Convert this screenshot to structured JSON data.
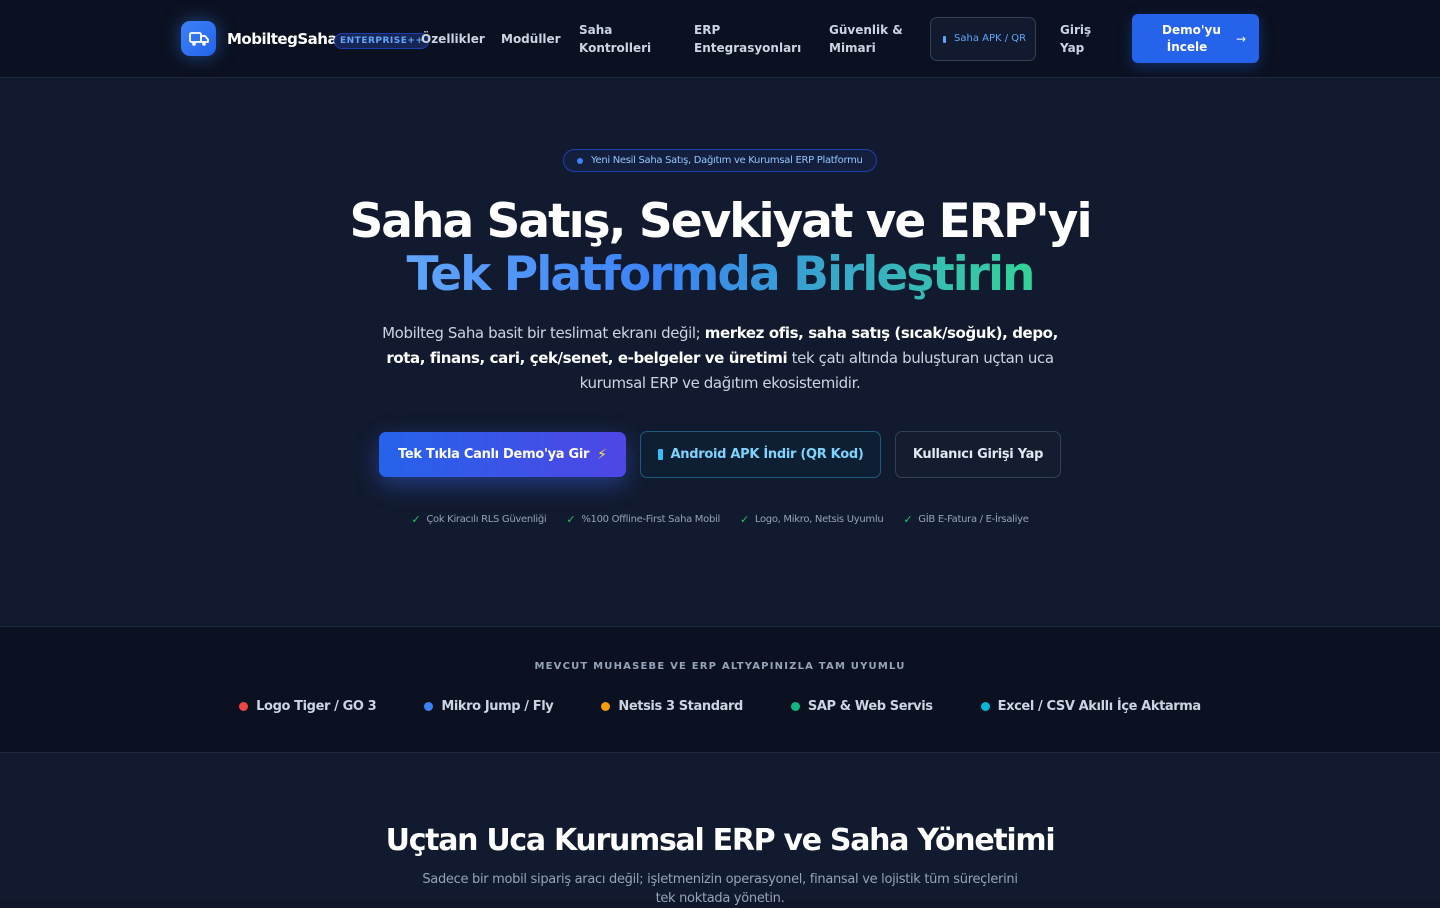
{
  "nav": {
    "brand": "MobiltegSaha",
    "badge": "ENTERPRISE++",
    "links": [
      {
        "label": "Özellikler"
      },
      {
        "label": "Modüller"
      },
      {
        "label": "Saha Kontrolleri"
      },
      {
        "label": "ERP Entegrasyonları"
      },
      {
        "label": "Güvenlik & Mimari"
      }
    ],
    "apk_label": "Saha APK / QR",
    "login_label": "Giriş Yap",
    "demo_label": "Demo'yu İncele",
    "demo_arrow": "→"
  },
  "hero": {
    "pill": "Yeni Nesil Saha Satış, Dağıtım ve Kurumsal ERP Platformu",
    "title_line1": "Saha Satış, Sevkiyat ve ERP'yi",
    "title_line2": "Tek Platformda Birleştirin",
    "subtitle": {
      "part1": "Mobilteg Saha basit bir teslimat ekranı değil; ",
      "bold": "merkez ofis, saha satış (sıcak/soğuk), depo, rota, finans, cari, çek/senet, e-belgeler ve üretimi",
      "part2": " tek çatı altında buluşturan uçtan uca kurumsal ERP ve dağıtım ekosistemidir."
    },
    "cta_demo": "Tek Tıkla Canlı Demo'ya Gir",
    "cta_demo_icon": "⚡",
    "cta_apk": "Android APK İndir (QR Kod)",
    "cta_login": "Kullanıcı Girişi Yap",
    "checks": [
      "Çok Kiracılı RLS Güvenliği",
      "%100 Offline-First Saha Mobil",
      "Logo, Mikro, Netsis Uyumlu",
      "GİB E-Fatura / E-İrsaliye"
    ],
    "check_mark": "✓"
  },
  "integrations": {
    "title": "MEVCUT MUHASEBE VE ERP ALTYAPINIZLA TAM UYUMLU",
    "items": [
      {
        "label": "Logo Tiger / GO 3",
        "color": "#ef4444"
      },
      {
        "label": "Mikro Jump / Fly",
        "color": "#3b82f6"
      },
      {
        "label": "Netsis 3 Standard",
        "color": "#f59e0b"
      },
      {
        "label": "SAP & Web Servis",
        "color": "#10b981"
      },
      {
        "label": "Excel / CSV Akıllı İçe Aktarma",
        "color": "#06b6d4"
      }
    ]
  },
  "section": {
    "title": "Uçtan Uca Kurumsal ERP ve Saha Yönetimi",
    "subtitle": "Sadece bir mobil sipariş aracı değil; işletmenizin operasyonel, finansal ve lojistik tüm süreçlerini tek noktada yönetin."
  },
  "colors": {
    "accent": "#2563eb",
    "background": "#111a2e",
    "nav_background": "#0b1120"
  }
}
